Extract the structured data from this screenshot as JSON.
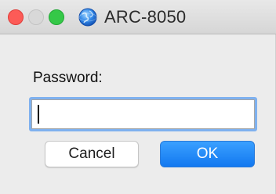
{
  "window": {
    "title": "ARC-8050",
    "app_icon": "globe-icon"
  },
  "dialog": {
    "password_label": "Password:",
    "password_value": "",
    "cancel_label": "Cancel",
    "ok_label": "OK"
  },
  "colors": {
    "close": "#fc5b57",
    "minimize": "#d8d8d8",
    "zoom": "#35c848",
    "focus_ring": "#7fb1ef",
    "ok_button": "#1278f0"
  }
}
